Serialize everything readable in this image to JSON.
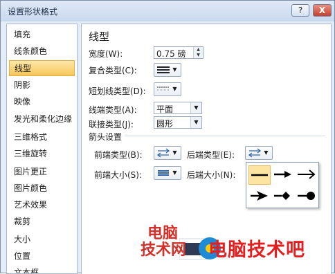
{
  "window": {
    "title": "设置形状格式",
    "help": "?",
    "close": "X"
  },
  "sidebar": {
    "items": [
      {
        "label": "填充"
      },
      {
        "label": "线条颜色"
      },
      {
        "label": "线型"
      },
      {
        "label": "阴影"
      },
      {
        "label": "映像"
      },
      {
        "label": "发光和柔化边缘"
      },
      {
        "label": "三维格式"
      },
      {
        "label": "三维旋转"
      },
      {
        "label": "图片更正"
      },
      {
        "label": "图片颜色"
      },
      {
        "label": "艺术效果"
      },
      {
        "label": "裁剪"
      },
      {
        "label": "大小"
      },
      {
        "label": "位置"
      },
      {
        "label": "文本框"
      }
    ],
    "active": "线型"
  },
  "panel": {
    "heading": "线型",
    "width_label": "宽度(W):",
    "width_value": "0.75 磅",
    "compound_label": "复合类型(C):",
    "dash_label": "短划线类型(D):",
    "cap_label": "线端类型(A):",
    "cap_value": "平面",
    "join_label": "联接类型(J):",
    "join_value": "圆形",
    "arrow_section": "箭头设置",
    "begin_type_label": "前端类型(B):",
    "end_type_label": "后端类型(E):",
    "begin_size_label": "前端大小(S):",
    "end_size_label": "后端大小(N):"
  },
  "watermark": {
    "text": "电脑技术吧",
    "small_top": "电脑",
    "small_bottom": "技术网"
  },
  "colors": {
    "accent": "#f7c75a",
    "logo": "#e41e1e"
  }
}
